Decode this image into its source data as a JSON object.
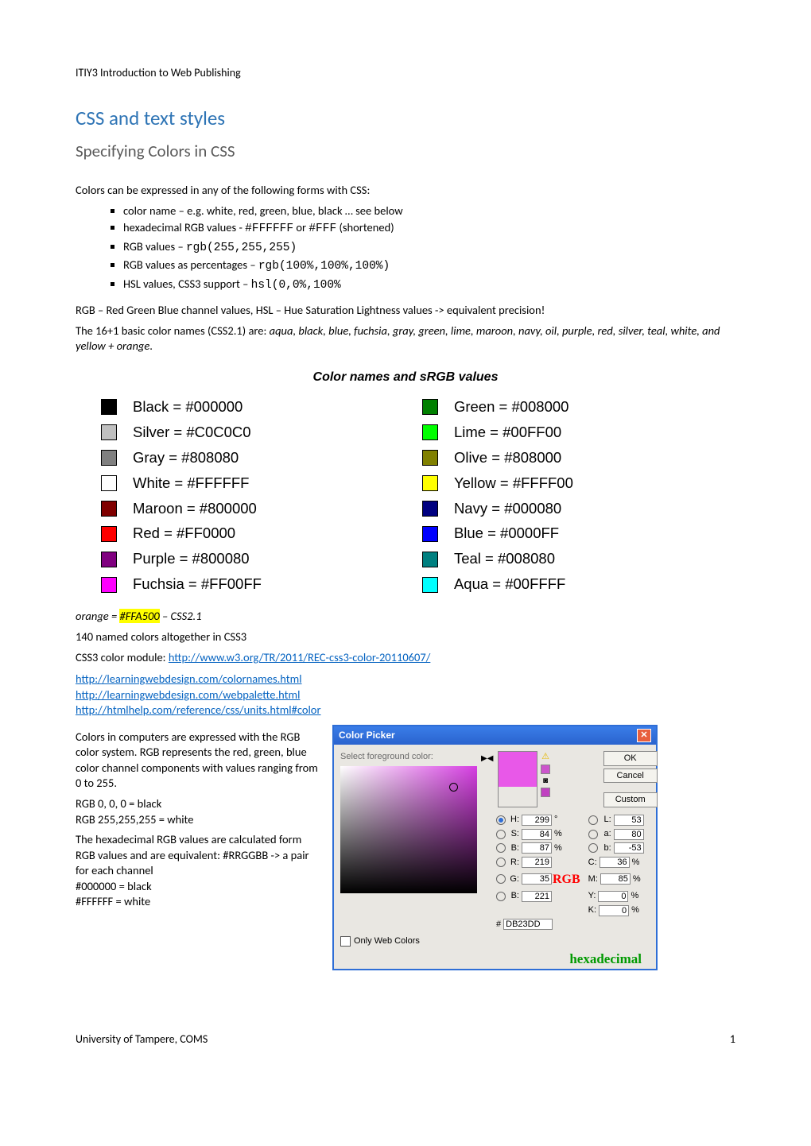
{
  "header": "ITIY3 Introduction to Web Publishing",
  "h1": "CSS and text styles",
  "h2": "Specifying Colors in CSS",
  "intro": "Colors can be expressed in any of the following forms with CSS:",
  "forms": [
    {
      "pre": "color name – e.g. white, red, green, blue, black … see below",
      "code": ""
    },
    {
      "pre": "hexadecimal RGB values - ",
      "code": "#FFFFFF",
      "mid": "  or  ",
      "code2": "#FFF",
      "post": "  (shortened)"
    },
    {
      "pre": "RGB values – ",
      "code": "rgb(255,255,255)"
    },
    {
      "pre": "RGB values as percentages – ",
      "code": "rgb(100%,100%,100%)"
    },
    {
      "pre": "HSL values, CSS3 support – ",
      "code": "hsl(0,0%,100%"
    }
  ],
  "rgb_hsl": "RGB – Red Green Blue channel values, HSL – Hue Saturation Lightness values -> equivalent precision!",
  "names_lead": "The 16+1 basic color names (CSS2.1) are: ",
  "names_ital": "aqua, black, blue, fuchsia, gray, green, lime, maroon, navy, oil, purple, red, silver, teal, white, and yellow + orange",
  "names_tail": ".",
  "swatch_title": "Color names and sRGB values",
  "left_sw": [
    {
      "hex": "#000000",
      "label": "Black = #000000"
    },
    {
      "hex": "#C0C0C0",
      "label": "Silver = #C0C0C0"
    },
    {
      "hex": "#808080",
      "label": "Gray = #808080"
    },
    {
      "hex": "#FFFFFF",
      "label": "White = #FFFFFF"
    },
    {
      "hex": "#800000",
      "label": "Maroon = #800000"
    },
    {
      "hex": "#FF0000",
      "label": "Red = #FF0000"
    },
    {
      "hex": "#800080",
      "label": "Purple = #800080"
    },
    {
      "hex": "#FF00FF",
      "label": "Fuchsia = #FF00FF"
    }
  ],
  "right_sw": [
    {
      "hex": "#008000",
      "label": "Green = #008000"
    },
    {
      "hex": "#00FF00",
      "label": "Lime = #00FF00"
    },
    {
      "hex": "#808000",
      "label": "Olive = #808000"
    },
    {
      "hex": "#FFFF00",
      "label": "Yellow = #FFFF00"
    },
    {
      "hex": "#000080",
      "label": "Navy = #000080"
    },
    {
      "hex": "#0000FF",
      "label": "Blue = #0000FF"
    },
    {
      "hex": "#008080",
      "label": "Teal = #008080"
    },
    {
      "hex": "#00FFFF",
      "label": "Aqua = #00FFFF"
    }
  ],
  "orange_pre": "orange = ",
  "orange_hex": "#FFA500",
  "orange_post": " – CSS2.1",
  "count_line": "140 named colors altogether in CSS3",
  "css3_lead": "CSS3 color module: ",
  "links": {
    "css3": "http://www.w3.org/TR/2011/REC-css3-color-20110607/",
    "l1": "http://learningwebdesign.com/colornames.html",
    "l2": "http://learningwebdesign.com/webpalette.html",
    "l3": "http://htmlhelp.com/reference/css/units.html#color"
  },
  "para1": "Colors in computers are expressed with the RGB color system. RGB represents the red, green, blue color channel components with values ranging from 0 to 255.",
  "para2a": "RGB 0, 0, 0 = black",
  "para2b": "RGB 255,255,255 = white",
  "para3": "The hexadecimal RGB values are calculated form RGB values and are equivalent: #RRGGBB -> a pair for each channel",
  "para3b": "#000000 = black",
  "para3c": "#FFFFFF = white",
  "picker": {
    "title": "Color Picker",
    "select": "Select foreground color:",
    "ok": "OK",
    "cancel": "Cancel",
    "custom": "Custom",
    "preview_top": "#e858e8",
    "preview_bottom": "#e858e8",
    "warn_sw1": "#cc55cc",
    "warn_sw2": "#c040c0",
    "H": "299",
    "S": "84",
    "Bv": "87",
    "L": "53",
    "a": "80",
    "b": "-53",
    "R": "219",
    "G": "35",
    "Bch": "221",
    "C": "36",
    "M": "85",
    "Y": "0",
    "K": "0",
    "hex": "DB23DD",
    "rgb_anno": "RGB",
    "hex_anno": "hexadecimal",
    "owc": "Only Web Colors",
    "deg": "°",
    "pct": "%",
    "hash": "#"
  },
  "footer_left": "University of Tampere, COMS",
  "footer_right": "1"
}
